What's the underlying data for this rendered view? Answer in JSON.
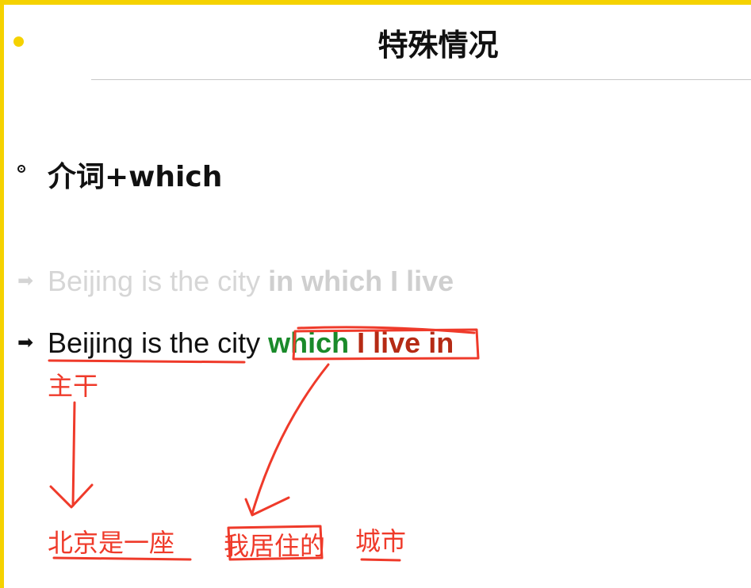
{
  "slide": {
    "title": "特殊情况",
    "heading": "介词+which"
  },
  "examples": {
    "faded": {
      "prefix": "Beijing is the city ",
      "emphasis": "in which I live"
    },
    "active": {
      "prefix": "Beijing is the city ",
      "which": "which",
      "rest": " I live in"
    }
  },
  "annotations": {
    "main_clause_label": "主干",
    "translation_part1": "北京是一座",
    "translation_part2": "我居住的",
    "translation_part3": "城市"
  },
  "colors": {
    "frame": "#f5d200",
    "ink_red": "#ef3a2a",
    "which_green": "#1a8a2a",
    "clause_red": "#b52a14"
  },
  "icons": {
    "bullet": "ring-bullet-icon",
    "example_marker": "right-arrow-icon"
  }
}
